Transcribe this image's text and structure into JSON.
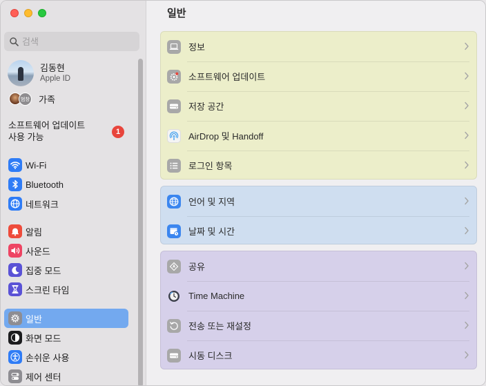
{
  "sidebar": {
    "search_placeholder": "검색",
    "profile": {
      "name": "김동현",
      "subtitle": "Apple ID"
    },
    "family": {
      "avatar_text": "범창",
      "label": "가족"
    },
    "update": {
      "line1": "소프트웨어 업데이트",
      "line2": "사용 가능",
      "badge": "1"
    },
    "items": [
      {
        "label": "Wi-Fi",
        "icon": "wifi-icon",
        "color": "#2f7cf6"
      },
      {
        "label": "Bluetooth",
        "icon": "bluetooth-icon",
        "color": "#2f7cf6"
      },
      {
        "label": "네트워크",
        "icon": "globe-icon",
        "color": "#2f7cf6"
      },
      {
        "label": "알림",
        "icon": "bell-icon",
        "color": "#ee4b3b"
      },
      {
        "label": "사운드",
        "icon": "speaker-icon",
        "color": "#ee4463"
      },
      {
        "label": "집중 모드",
        "icon": "moon-icon",
        "color": "#5a52d6"
      },
      {
        "label": "스크린 타임",
        "icon": "hourglass-icon",
        "color": "#5a52d6"
      },
      {
        "label": "일반",
        "icon": "gear-icon",
        "color": "#8e8d92",
        "selected": true
      },
      {
        "label": "화면 모드",
        "icon": "appearance-icon",
        "color": "#1c1c1e"
      },
      {
        "label": "손쉬운 사용",
        "icon": "accessibility-icon",
        "color": "#2f7cf6"
      },
      {
        "label": "제어 센터",
        "icon": "control-center-icon",
        "color": "#8e8d92"
      }
    ]
  },
  "main": {
    "title": "일반",
    "groups": [
      {
        "color": "#eceeca",
        "rows": [
          {
            "label": "정보",
            "icon": "laptop-icon"
          },
          {
            "label": "소프트웨어 업데이트",
            "icon": "gear-badge-icon"
          },
          {
            "label": "저장 공간",
            "icon": "storage-icon"
          },
          {
            "label": "AirDrop 및 Handoff",
            "icon": "airdrop-icon"
          },
          {
            "label": "로그인 항목",
            "icon": "list-icon"
          }
        ]
      },
      {
        "color": "#cfdef0",
        "rows": [
          {
            "label": "언어 및 지역",
            "icon": "globe-icon"
          },
          {
            "label": "날짜 및 시간",
            "icon": "calendar-clock-icon"
          }
        ]
      },
      {
        "color": "#d6d0ea",
        "rows": [
          {
            "label": "공유",
            "icon": "sharing-icon"
          },
          {
            "label": "Time Machine",
            "icon": "time-machine-icon"
          },
          {
            "label": "전송 또는 재설정",
            "icon": "reset-icon"
          },
          {
            "label": "시동 디스크",
            "icon": "disk-icon"
          }
        ]
      }
    ]
  }
}
